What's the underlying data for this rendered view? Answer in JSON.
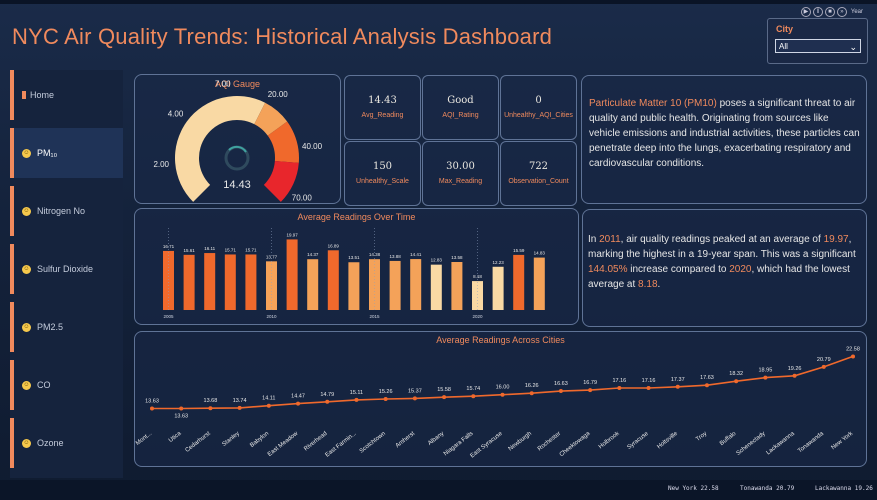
{
  "title": "NYC Air Quality Trends: Historical Analysis Dashboard",
  "playback": {
    "year_label": "Year"
  },
  "city_filter": {
    "label": "City",
    "selected": "All"
  },
  "sidebar": {
    "items": [
      {
        "label": "Home",
        "icon": "home-icon"
      },
      {
        "label": "PM₁₀",
        "icon": "smiley-icon",
        "active": true
      },
      {
        "label": "Nitrogen No",
        "icon": "smiley-icon"
      },
      {
        "label": "Sulfur Dioxide",
        "icon": "smiley-icon"
      },
      {
        "label": "PM2.5",
        "icon": "smiley-icon"
      },
      {
        "label": "CO",
        "icon": "smiley-icon"
      },
      {
        "label": "Ozone",
        "icon": "smiley-icon"
      }
    ]
  },
  "gauge": {
    "title": "AQI Gauge",
    "value": 14.43,
    "value_label": "14.43",
    "ticks": [
      "1.00",
      "2.00",
      "4.00",
      "7.00",
      "20.00",
      "40.00",
      "70.00"
    ],
    "colors": {
      "low": "#f9d9a4",
      "mid": "#f4a259",
      "high": "#f0692c",
      "severe": "#e8262c"
    }
  },
  "kpis": [
    {
      "value": "14.43",
      "label": "Avg_Reading"
    },
    {
      "value": "Good",
      "label": "AQI_Rating"
    },
    {
      "value": "0",
      "label": "Unhealthy_AQI_Cities"
    },
    {
      "value": "150",
      "label": "Unhealthy_Scale"
    },
    {
      "value": "30.00",
      "label": "Max_Reading"
    },
    {
      "value": "722",
      "label": "Observation_Count"
    }
  ],
  "description": {
    "highlight": "Particulate Matter 10 (PM10)",
    "text": " poses a significant threat to air quality and public health. Originating from sources like vehicle emissions and industrial activities, these particles can penetrate deep into the lungs, exacerbating respiratory and cardiovascular conditions."
  },
  "insight": {
    "p1": "In ",
    "year": "2011",
    "p2": ", air quality readings peaked at an average of ",
    "peak": "19.97",
    "p3": ", marking the highest in a 19-year span. This was a significant ",
    "pct": "144.05%",
    "p4": " increase compared to ",
    "low_year": "2020",
    "p5": ", which had the lowest average at ",
    "low_val": "8.18",
    "p6": "."
  },
  "chart_data": [
    {
      "type": "bar",
      "title": "Average Readings Over Time",
      "categories": [
        "2005",
        "2006",
        "2007",
        "2008",
        "2009",
        "2010",
        "2011",
        "2012",
        "2013",
        "2014",
        "2015",
        "2016",
        "2017",
        "2018",
        "2019",
        "2020",
        "2021",
        "2022",
        "2023"
      ],
      "values": [
        16.71,
        15.61,
        16.11,
        15.71,
        15.71,
        13.77,
        19.97,
        14.37,
        16.89,
        13.51,
        14.38,
        13.88,
        14.41,
        12.83,
        13.58,
        8.18,
        12.23,
        15.59,
        14.83
      ],
      "data_labels": [
        "16.71",
        "15.61",
        "16.11",
        "15.71",
        "15.71",
        "13.77",
        "19.97",
        "14.37",
        "16.89",
        "13.51",
        "14.38",
        "13.88",
        "14.41",
        "12.83",
        "13.58",
        "8.18",
        "12.23",
        "15.59",
        "14.83"
      ],
      "tick_labels": [
        "2005",
        "2010",
        "2015",
        "2020"
      ],
      "ylim": [
        0,
        22
      ],
      "colors": [
        "#f0692c",
        "#f4a259",
        "#f9d9a4"
      ]
    },
    {
      "type": "line",
      "title": "Average Readings Across Cities",
      "categories": [
        "Mont...",
        "Utica",
        "Cedarhurst",
        "Stanley",
        "Babylon",
        "East Meadow",
        "Riverhead",
        "East Farmin...",
        "Scotchtown",
        "Amherst",
        "Albany",
        "Niagara Falls",
        "East Syracuse",
        "Newburgh",
        "Rochester",
        "Cheektowaga",
        "Holbrook",
        "Syracuse",
        "Holtsville",
        "Troy",
        "Buffalo",
        "Schenectady",
        "Lackawanna",
        "Tonawanda",
        "New York"
      ],
      "values": [
        13.63,
        13.63,
        13.68,
        13.74,
        14.11,
        14.47,
        14.79,
        15.11,
        15.26,
        15.37,
        15.58,
        15.74,
        16.0,
        16.26,
        16.63,
        16.79,
        17.16,
        17.16,
        17.37,
        17.63,
        18.32,
        18.95,
        19.26,
        20.79,
        22.58
      ],
      "data_labels": [
        "13.63",
        "13.63",
        "13.68",
        "13.74",
        "14.11",
        "14.47",
        "14.79",
        "15.11",
        "15.26",
        "15.37",
        "15.58",
        "15.74",
        "16.00",
        "16.26",
        "16.63",
        "16.79",
        "17.16",
        "17.16",
        "17.37",
        "17.63",
        "18.32",
        "18.95",
        "19.26",
        "20.79",
        "22.58"
      ],
      "ylim": [
        12,
        23
      ],
      "color": "#f0692c"
    }
  ],
  "ticker": [
    {
      "city": "New York",
      "value": "22.58"
    },
    {
      "city": "Tonawanda",
      "value": "20.79"
    },
    {
      "city": "Lackawanna",
      "value": "19.26"
    }
  ]
}
